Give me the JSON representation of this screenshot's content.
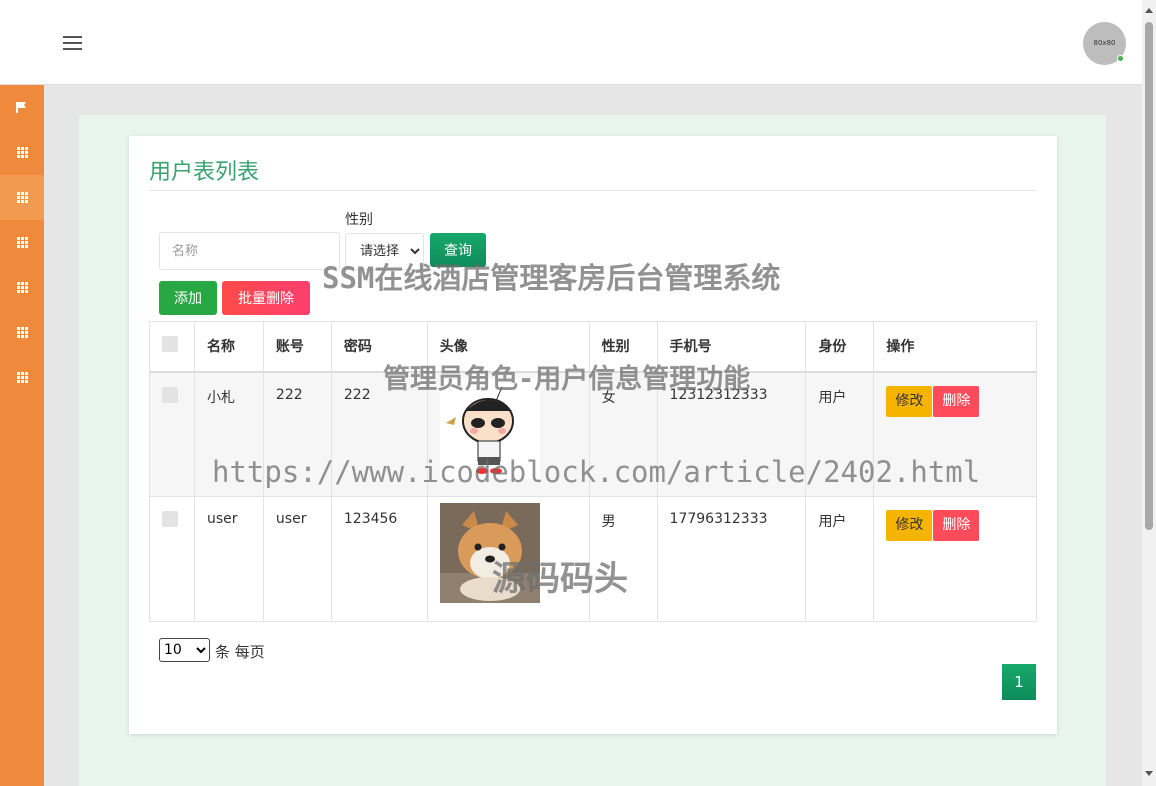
{
  "header": {
    "avatar_text": "80x80"
  },
  "page": {
    "title": "用户表列表"
  },
  "search": {
    "name_placeholder": "名称",
    "gender_label": "性别",
    "gender_selected": "请选择",
    "query_label": "查询"
  },
  "actions": {
    "add_label": "添加",
    "batch_delete_label": "批量删除"
  },
  "table": {
    "headers": [
      "名称",
      "账号",
      "密码",
      "头像",
      "性别",
      "手机号",
      "身份",
      "操作"
    ],
    "rows": [
      {
        "name": "小札",
        "account": "222",
        "password": "222",
        "avatar": "cartoon-boy-avatar",
        "gender": "女",
        "phone": "12312312333",
        "role": "用户"
      },
      {
        "name": "user",
        "account": "user",
        "password": "123456",
        "avatar": "shiba-dog-avatar",
        "gender": "男",
        "phone": "17796312333",
        "role": "用户"
      }
    ],
    "edit_label": "修改",
    "delete_label": "删除"
  },
  "pagination": {
    "page_size": "10",
    "per_page_label": "条 每页",
    "current_page": "1"
  },
  "watermarks": {
    "line1": "SSM在线酒店管理客房后台管理系统",
    "line2": "管理员角色-用户信息管理功能",
    "line3": "https://www.icodeblock.com/article/2402.html",
    "line4": "源码码头"
  },
  "colors": {
    "sidebar": "#ef8a3c",
    "accent_green": "#3aa372",
    "danger": "#ff4b5a",
    "warning": "#f5b400"
  }
}
